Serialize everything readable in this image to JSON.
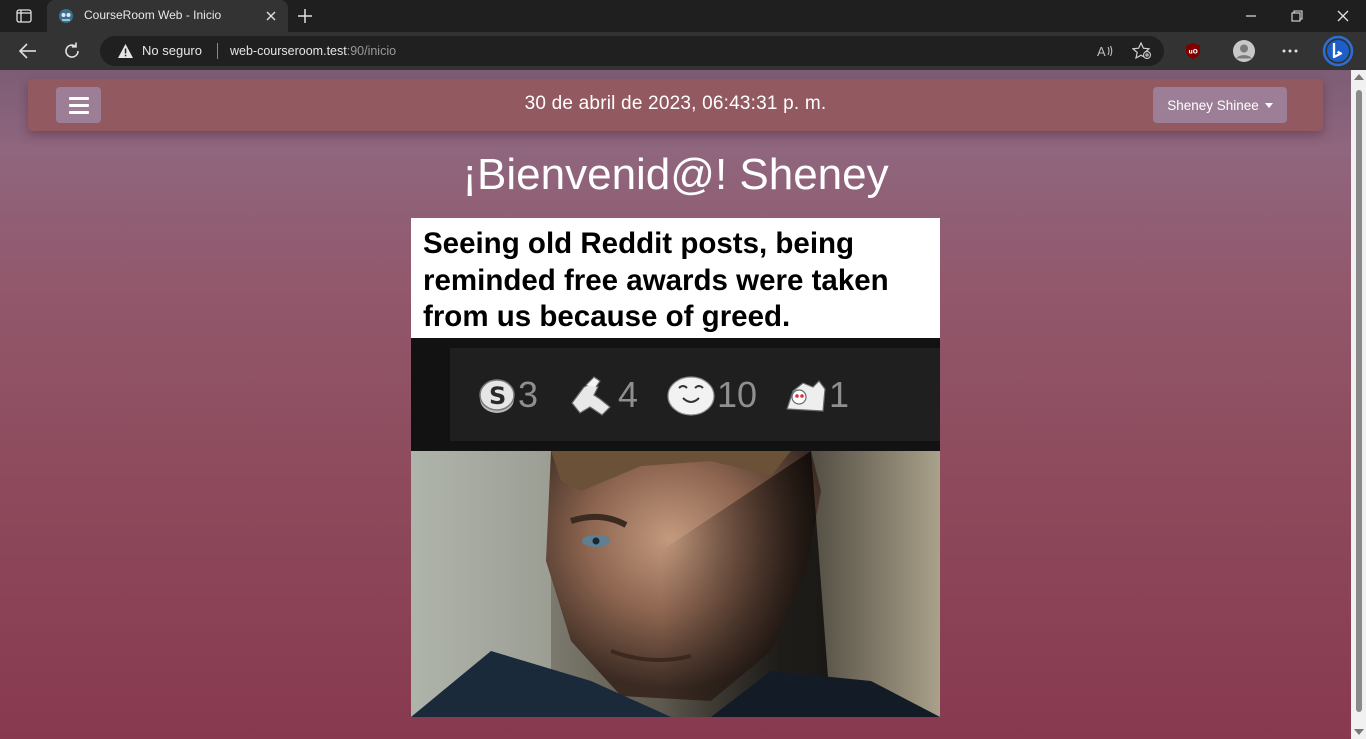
{
  "browser": {
    "tab_title": "CourseRoom Web - Inicio",
    "security_label": "No seguro",
    "url_host": "web-courseroom.test",
    "url_rest": ":90/inicio"
  },
  "navbar": {
    "datetime": "30 de abril de 2023, 06:43:31 p. m.",
    "user_name": "Sheney Shinee"
  },
  "welcome": "¡Bienvenid@! Sheney",
  "meme": {
    "caption": "Seeing old Reddit posts, being reminded free awards were taken from us because of greed.",
    "awards": [
      {
        "icon": "silver-award-icon",
        "count": "3"
      },
      {
        "icon": "helpful-award-icon",
        "count": "4"
      },
      {
        "icon": "wholesome-award-icon",
        "count": "10"
      },
      {
        "icon": "hugz-award-icon",
        "count": "1"
      }
    ]
  },
  "colors": {
    "navbar_bg": "#925a60",
    "button_bg": "#9c7f96",
    "page_gradient_top": "#7c5d75",
    "page_gradient_bottom": "#88394f"
  }
}
